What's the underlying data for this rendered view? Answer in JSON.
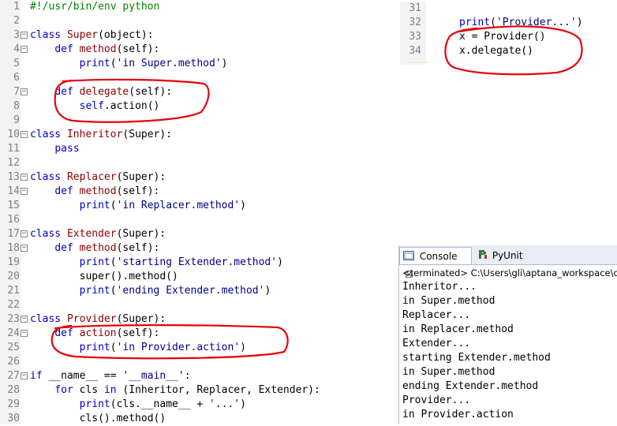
{
  "editor": {
    "lines": [
      {
        "n": "1",
        "fold": false,
        "tokens": [
          [
            "cm",
            "#!/usr/bin/env python"
          ]
        ]
      },
      {
        "n": "2",
        "fold": false,
        "tokens": []
      },
      {
        "n": "3",
        "fold": true,
        "tokens": [
          [
            "kw",
            "class "
          ],
          [
            "cls",
            "Super"
          ],
          [
            "pl",
            "(object):"
          ]
        ]
      },
      {
        "n": "4",
        "fold": true,
        "tokens": [
          [
            "pl",
            "    "
          ],
          [
            "kw",
            "def "
          ],
          [
            "fn",
            "method"
          ],
          [
            "pl",
            "(self):"
          ]
        ]
      },
      {
        "n": "5",
        "fold": false,
        "tokens": [
          [
            "pl",
            "        "
          ],
          [
            "kw",
            "print"
          ],
          [
            "pl",
            "("
          ],
          [
            "str",
            "'in Super.method'"
          ],
          [
            "pl",
            ")"
          ]
        ]
      },
      {
        "n": "6",
        "fold": false,
        "tokens": []
      },
      {
        "n": "7",
        "fold": true,
        "tokens": [
          [
            "pl",
            "    "
          ],
          [
            "kw",
            "def "
          ],
          [
            "fn",
            "delegate"
          ],
          [
            "pl",
            "(self):"
          ]
        ]
      },
      {
        "n": "8",
        "fold": false,
        "tokens": [
          [
            "pl",
            "        "
          ],
          [
            "kw",
            "self"
          ],
          [
            "pl",
            ".action()"
          ]
        ]
      },
      {
        "n": "9",
        "fold": false,
        "tokens": []
      },
      {
        "n": "10",
        "fold": true,
        "tokens": [
          [
            "kw",
            "class "
          ],
          [
            "cls",
            "Inheritor"
          ],
          [
            "pl",
            "(Super):"
          ]
        ]
      },
      {
        "n": "11",
        "fold": false,
        "tokens": [
          [
            "pl",
            "    "
          ],
          [
            "kw",
            "pass"
          ]
        ]
      },
      {
        "n": "12",
        "fold": false,
        "tokens": []
      },
      {
        "n": "13",
        "fold": true,
        "tokens": [
          [
            "kw",
            "class "
          ],
          [
            "cls",
            "Replacer"
          ],
          [
            "pl",
            "(Super):"
          ]
        ]
      },
      {
        "n": "14",
        "fold": true,
        "tokens": [
          [
            "pl",
            "    "
          ],
          [
            "kw",
            "def "
          ],
          [
            "fn",
            "method"
          ],
          [
            "pl",
            "(self):"
          ]
        ]
      },
      {
        "n": "15",
        "fold": false,
        "tokens": [
          [
            "pl",
            "        "
          ],
          [
            "kw",
            "print"
          ],
          [
            "pl",
            "("
          ],
          [
            "str",
            "'in Replacer.method'"
          ],
          [
            "pl",
            ")"
          ]
        ]
      },
      {
        "n": "16",
        "fold": false,
        "tokens": []
      },
      {
        "n": "17",
        "fold": true,
        "tokens": [
          [
            "kw",
            "class "
          ],
          [
            "cls",
            "Extender"
          ],
          [
            "pl",
            "(Super):"
          ]
        ]
      },
      {
        "n": "18",
        "fold": true,
        "tokens": [
          [
            "pl",
            "    "
          ],
          [
            "kw",
            "def "
          ],
          [
            "fn",
            "method"
          ],
          [
            "pl",
            "(self):"
          ]
        ]
      },
      {
        "n": "19",
        "fold": false,
        "tokens": [
          [
            "pl",
            "        "
          ],
          [
            "kw",
            "print"
          ],
          [
            "pl",
            "("
          ],
          [
            "str",
            "'starting Extender.method'"
          ],
          [
            "pl",
            ")"
          ]
        ]
      },
      {
        "n": "20",
        "fold": false,
        "tokens": [
          [
            "pl",
            "        super().method()"
          ]
        ]
      },
      {
        "n": "21",
        "fold": false,
        "tokens": [
          [
            "pl",
            "        "
          ],
          [
            "kw",
            "print"
          ],
          [
            "pl",
            "("
          ],
          [
            "str",
            "'ending Extender.method'"
          ],
          [
            "pl",
            ")"
          ]
        ]
      },
      {
        "n": "22",
        "fold": false,
        "tokens": []
      },
      {
        "n": "23",
        "fold": true,
        "tokens": [
          [
            "kw",
            "class "
          ],
          [
            "cls",
            "Provider"
          ],
          [
            "pl",
            "(Super):"
          ]
        ]
      },
      {
        "n": "24",
        "fold": true,
        "tokens": [
          [
            "pl",
            "    "
          ],
          [
            "kw",
            "def "
          ],
          [
            "fn",
            "action"
          ],
          [
            "pl",
            "(self):"
          ]
        ]
      },
      {
        "n": "25",
        "fold": false,
        "tokens": [
          [
            "pl",
            "        "
          ],
          [
            "kw",
            "print"
          ],
          [
            "pl",
            "("
          ],
          [
            "str",
            "'in Provider.action'"
          ],
          [
            "pl",
            ")"
          ]
        ]
      },
      {
        "n": "26",
        "fold": false,
        "tokens": []
      },
      {
        "n": "27",
        "fold": true,
        "tokens": [
          [
            "kw",
            "if "
          ],
          [
            "pl",
            "__name__ == "
          ],
          [
            "str",
            "'__main__'"
          ],
          [
            "pl",
            ":"
          ]
        ]
      },
      {
        "n": "28",
        "fold": false,
        "tokens": [
          [
            "pl",
            "    "
          ],
          [
            "kw",
            "for "
          ],
          [
            "pl",
            "cls "
          ],
          [
            "kw",
            "in "
          ],
          [
            "pl",
            "(Inheritor, Replacer, Extender):"
          ]
        ]
      },
      {
        "n": "29",
        "fold": false,
        "tokens": [
          [
            "pl",
            "        "
          ],
          [
            "kw",
            "print"
          ],
          [
            "pl",
            "(cls.__name__ + "
          ],
          [
            "str",
            "'...'"
          ],
          [
            "pl",
            ")"
          ]
        ]
      },
      {
        "n": "30",
        "fold": false,
        "tokens": [
          [
            "pl",
            "        cls().method()"
          ]
        ]
      }
    ]
  },
  "snippet": {
    "lines": [
      {
        "n": "31",
        "tokens": []
      },
      {
        "n": "32",
        "tokens": [
          [
            "kw",
            "print"
          ],
          [
            "pl",
            "("
          ],
          [
            "str",
            "'Provider...'"
          ],
          [
            "pl",
            ")"
          ]
        ]
      },
      {
        "n": "33",
        "tokens": [
          [
            "pl",
            "x = Provider()"
          ]
        ]
      },
      {
        "n": "34",
        "tokens": [
          [
            "pl",
            "x.delegate()"
          ]
        ]
      }
    ]
  },
  "console": {
    "tab_console": "Console",
    "tab_close": "☒",
    "tab_pyunit": "PyUnit",
    "terminated": "<terminated> C:\\Users\\gli\\aptana_workspace\\c",
    "output": [
      "Inheritor...",
      "in Super.method",
      "Replacer...",
      "in Replacer.method",
      "Extender...",
      "starting Extender.method",
      "in Super.method",
      "ending Extender.method",
      "Provider...",
      "in Provider.action"
    ]
  },
  "colors": {
    "keyword": "#0000c0",
    "class_name": "#8b0000",
    "string": "#00008b",
    "comment": "#008000",
    "annotation": "#e8000a"
  }
}
